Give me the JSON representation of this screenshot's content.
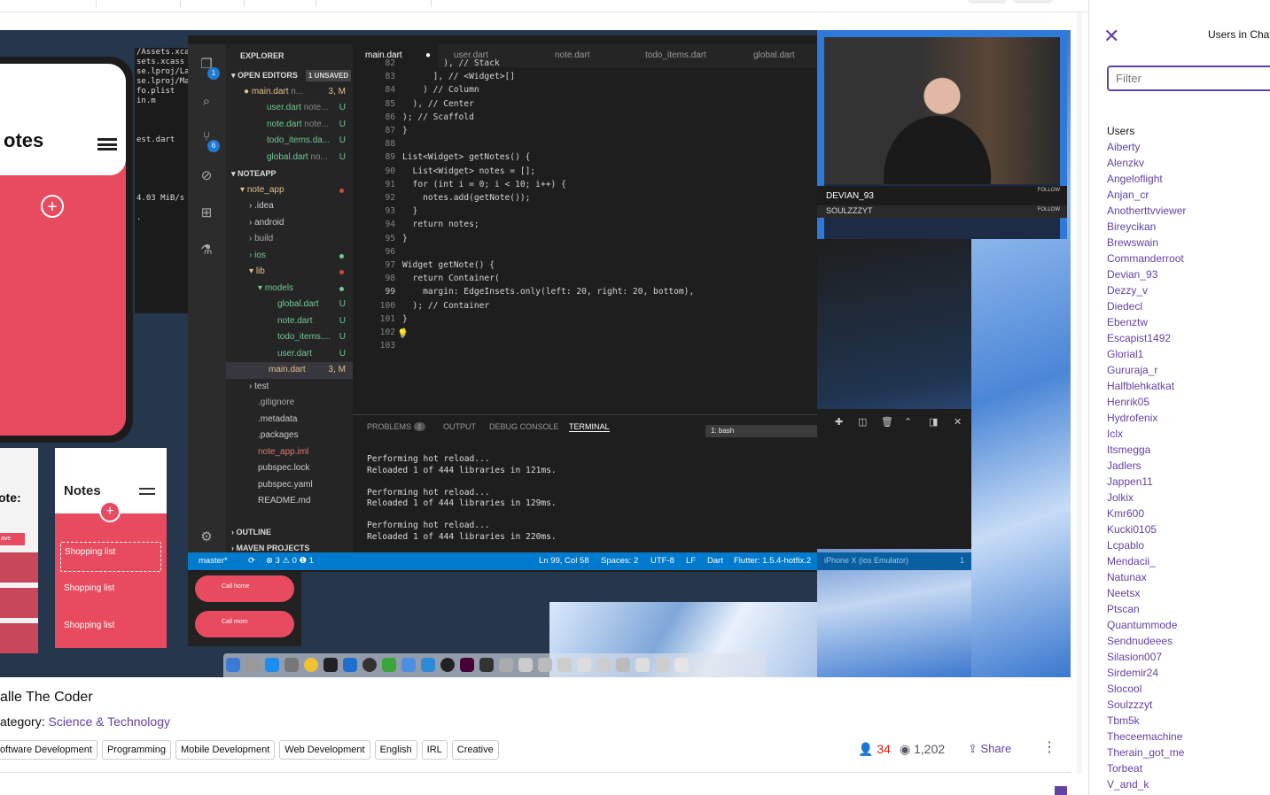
{
  "stream": {
    "title": "alle The Coder",
    "category_label": "ategory:",
    "category": "Science & Technology",
    "tags": [
      "oftware Development",
      "Programming",
      "Mobile Development",
      "Web Development",
      "English",
      "IRL",
      "Creative"
    ],
    "viewers": "34",
    "views": "1,202",
    "share_label": "Share"
  },
  "vscode": {
    "explorer_title": "EXPLORER",
    "open_editors": "OPEN EDITORS",
    "unsaved": "1 UNSAVED",
    "activity_badges": [
      "1",
      "6"
    ],
    "open_files": [
      {
        "name": "main.dart",
        "hint": "n...",
        "status": "3, M"
      },
      {
        "name": "user.dart",
        "hint": "note...",
        "status": "U"
      },
      {
        "name": "note.dart",
        "hint": "note...",
        "status": "U"
      },
      {
        "name": "todo_items.da...",
        "hint": "",
        "status": "U"
      },
      {
        "name": "global.dart",
        "hint": "no...",
        "status": "U"
      }
    ],
    "noteapp_label": "NOTEAPP",
    "tree": [
      {
        "name": "note_app",
        "status": ""
      },
      {
        "name": ".idea",
        "status": ""
      },
      {
        "name": "android",
        "status": ""
      },
      {
        "name": "build",
        "status": ""
      },
      {
        "name": "ios",
        "status": ""
      },
      {
        "name": "lib",
        "status": ""
      },
      {
        "name": "models",
        "status": ""
      },
      {
        "name": "global.dart",
        "status": "U"
      },
      {
        "name": "note.dart",
        "status": "U"
      },
      {
        "name": "todo_items....",
        "status": "U"
      },
      {
        "name": "user.dart",
        "status": "U"
      },
      {
        "name": "main.dart",
        "status": "3, M"
      },
      {
        "name": "test",
        "status": ""
      },
      {
        "name": ".gitignore",
        "status": ""
      },
      {
        "name": ".metadata",
        "status": ""
      },
      {
        "name": ".packages",
        "status": ""
      },
      {
        "name": "note_app.iml",
        "status": ""
      },
      {
        "name": "pubspec.lock",
        "status": ""
      },
      {
        "name": "pubspec.yaml",
        "status": ""
      },
      {
        "name": "README.md",
        "status": ""
      }
    ],
    "outline": "OUTLINE",
    "maven": "MAVEN PROJECTS",
    "tabs": [
      "main.dart",
      "user.dart",
      "note.dart",
      "todo_items.dart",
      "global.dart"
    ],
    "line_numbers": [
      "82",
      "83",
      "84",
      "85",
      "86",
      "87",
      "88",
      "89",
      "90",
      "91",
      "92",
      "93",
      "94",
      "95",
      "96",
      "97",
      "98",
      "99",
      "100",
      "101",
      "102",
      "103"
    ],
    "code_lines": [
      "        ), // Stack",
      "      ], // <Widget>[]",
      "    ) // Column",
      "  ), // Center",
      "); // Scaffold",
      "}",
      "",
      "List<Widget> getNotes() {",
      "  List<Widget> notes = [];",
      "  for (int i = 0; i < 10; i++) {",
      "    notes.add(getNote());",
      "  }",
      "  return notes;",
      "}",
      "",
      "Widget getNote() {",
      "  return Container(",
      "    margin: EdgeInsets.only(left: 20, right: 20, bottom),",
      "  ); // Container",
      "}",
      "}",
      ""
    ],
    "panel_tabs": [
      "PROBLEMS",
      "OUTPUT",
      "DEBUG CONSOLE",
      "TERMINAL"
    ],
    "problems_count": "4",
    "terminal_select": "1: bash",
    "terminal_output": "Performing hot reload...\nReloaded 1 of 444 libraries in 121ms.\n\nPerforming hot reload...\nReloaded 1 of 444 libraries in 129ms.\n\nPerforming hot reload...\nReloaded 1 of 444 libraries in 220ms.",
    "status": {
      "branch": "master*",
      "errors": "⊗ 3 ⚠ 0 ❶ 1",
      "position": "Ln 99, Col 58",
      "spaces": "Spaces: 2",
      "encoding": "UTF-8",
      "eol": "LF",
      "language": "Dart",
      "flutter": "Flutter: 1.5.4-hotfix.2",
      "device": "iPhone X (ios Emulator)",
      "bell": "1"
    }
  },
  "webcam": {
    "name": "DEVIAN_93",
    "name2": "SOULZZZYT",
    "follow": "FOLLOW"
  },
  "phone": {
    "title": "otes",
    "small_title": "Notes",
    "cards": [
      "Shopping list",
      "Shopping list",
      "Shopping list"
    ],
    "calls": [
      "Call home",
      "Call mom"
    ],
    "left_label": "ote:",
    "left_btn": "ave"
  },
  "left_terminal": "/Assets.xcasse\nsets.xcass\nse.lproj/La\nse.lproj/Ma\nfo.plist\nin.m\n\n\n\nest.dart\n\n\n\n\n\n4.03 MiB/s\n\n.",
  "chat": {
    "header": "Users in Chat",
    "filter_placeholder": "Filter",
    "users_label": "Users",
    "users": [
      "Aiberty",
      "Alenzkv",
      "Angeloflight",
      "Anjan_cr",
      "Anotherttvviewer",
      "Bireycikan",
      "Brewswain",
      "Commanderroot",
      "Devian_93",
      "Dezzy_v",
      "Diedecl",
      "Ebenztw",
      "Escapist1492",
      "Glorial1",
      "Gururaja_r",
      "Halfblehkatkat",
      "Henrik05",
      "Hydrofenix",
      "Iclx",
      "Itsmegga",
      "Jadlers",
      "Jappen11",
      "Jolkix",
      "Kmr600",
      "Kucki0105",
      "Lcpablo",
      "Mendacii_",
      "Natunax",
      "Neetsx",
      "Ptscan",
      "Quantummode",
      "Sendnudeees",
      "Silasion007",
      "Sirdemir24",
      "Slocool",
      "Soulzzzyt",
      "Tbm5k",
      "Theceemachine",
      "Therain_got_me",
      "Torbeat",
      "V_and_k"
    ]
  },
  "colors": {
    "accent": "#6441a5",
    "vscode_blue": "#007acc",
    "phone_red": "#e84a5f",
    "viewer_red": "#e91916"
  }
}
